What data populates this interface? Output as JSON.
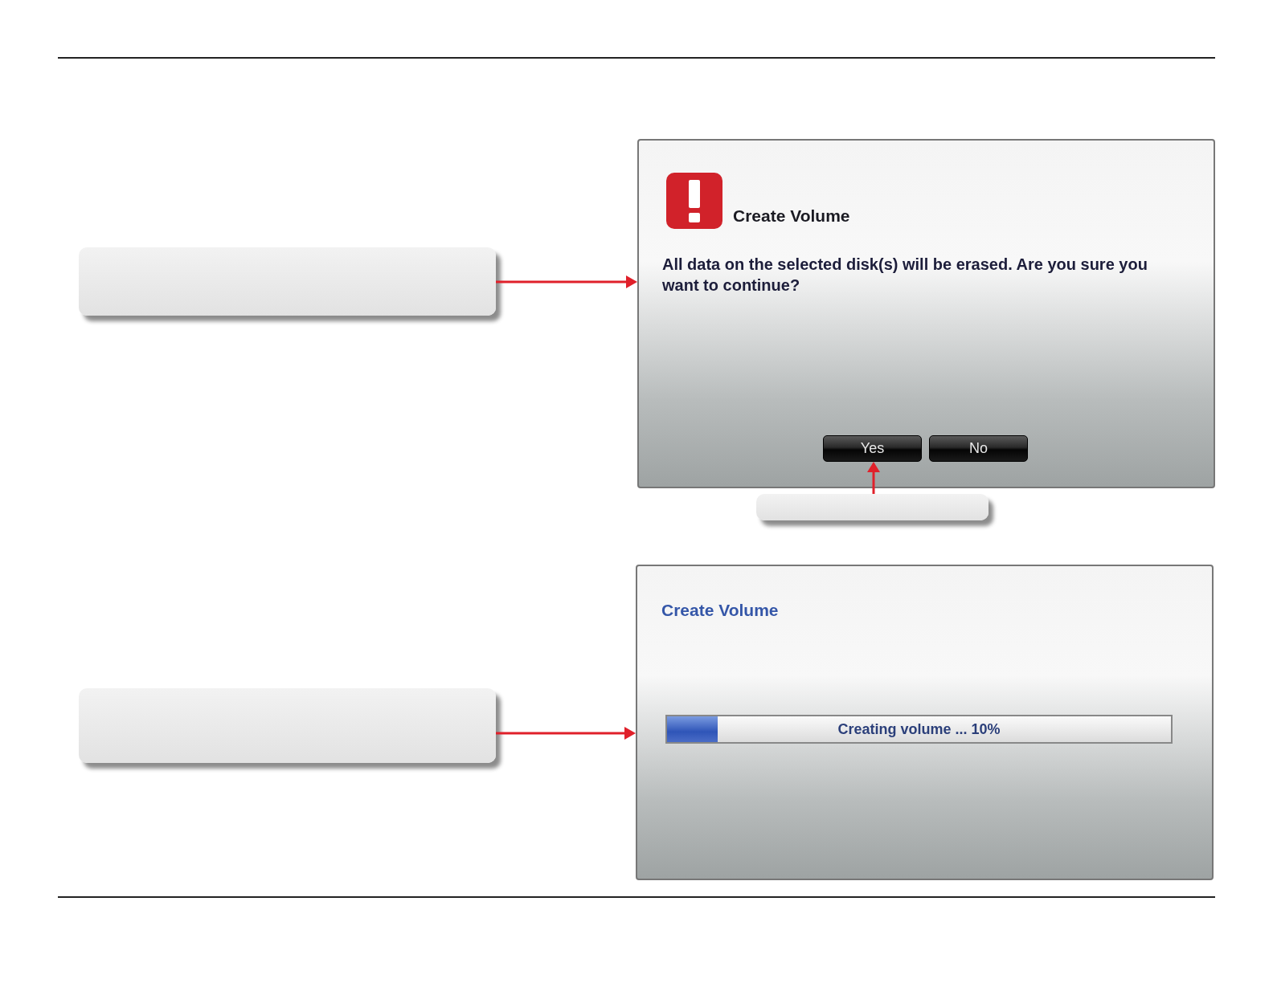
{
  "confirm_dialog": {
    "title": "Create Volume",
    "message": "All data on the selected disk(s) will be erased. Are you sure you want to continue?",
    "buttons": [
      {
        "label": "Yes"
      },
      {
        "label": "No"
      }
    ]
  },
  "progress_dialog": {
    "title": "Create Volume",
    "progress": {
      "label": "Creating volume ... 10%",
      "level": 0.1
    }
  }
}
